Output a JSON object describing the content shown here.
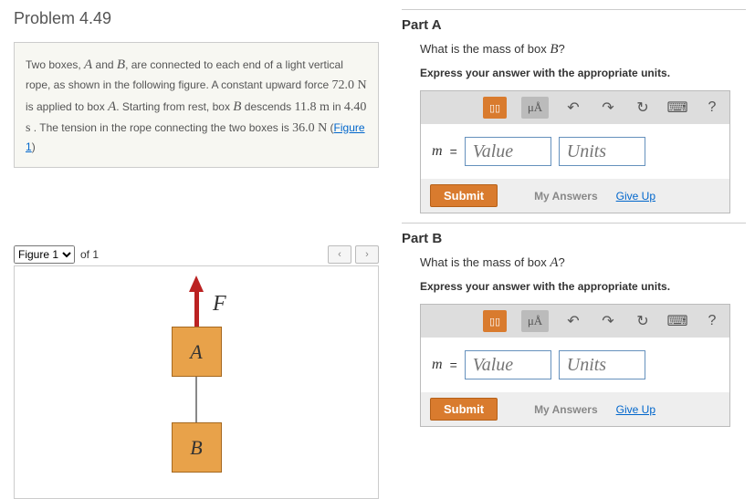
{
  "title": "Problem 4.49",
  "problem_text_1": "Two boxes, ",
  "problem_A": "A",
  "problem_and": " and ",
  "problem_B": "B",
  "problem_text_2": ", are connected to each end of a light vertical rope, as shown in the following figure. A constant upward force ",
  "force_val": "72.0 N",
  "problem_text_3": " is applied to box ",
  "problem_text_4": ". Starting from rest, box ",
  "problem_text_5": " descends ",
  "dist_val": "11.8 m",
  "problem_in": " in ",
  "time_val": "4.40 s",
  "problem_text_6": " . The tension in the rope connecting the two boxes is ",
  "tension_val": "36.0 N",
  "problem_text_7": " (",
  "fig_link": "Figure 1",
  "problem_text_8": ")",
  "figure_label": "Figure 1",
  "figure_of": "of 1",
  "nav_prev": "‹",
  "nav_next": "›",
  "fig_F": "F",
  "fig_boxA": "A",
  "fig_boxB": "B",
  "partA": {
    "title": "Part A",
    "question_1": "What is the mass of box ",
    "question_var": "B",
    "question_2": "?",
    "instr": "Express your answer with the appropriate units.",
    "var": "m",
    "eq": "=",
    "value_ph": "Value",
    "units_ph": "Units",
    "submit": "Submit",
    "myans": "My Answers",
    "giveup": "Give Up"
  },
  "partB": {
    "title": "Part B",
    "question_1": "What is the mass of box ",
    "question_var": "A",
    "question_2": "?",
    "instr": "Express your answer with the appropriate units.",
    "var": "m",
    "eq": "=",
    "value_ph": "Value",
    "units_ph": "Units",
    "submit": "Submit",
    "myans": "My Answers",
    "giveup": "Give Up"
  },
  "toolbar": {
    "frac": "▯▯",
    "mu": "μÅ",
    "undo": "↶",
    "redo": "↷",
    "reset": "↻",
    "keyboard": "⌨",
    "help": "?"
  }
}
